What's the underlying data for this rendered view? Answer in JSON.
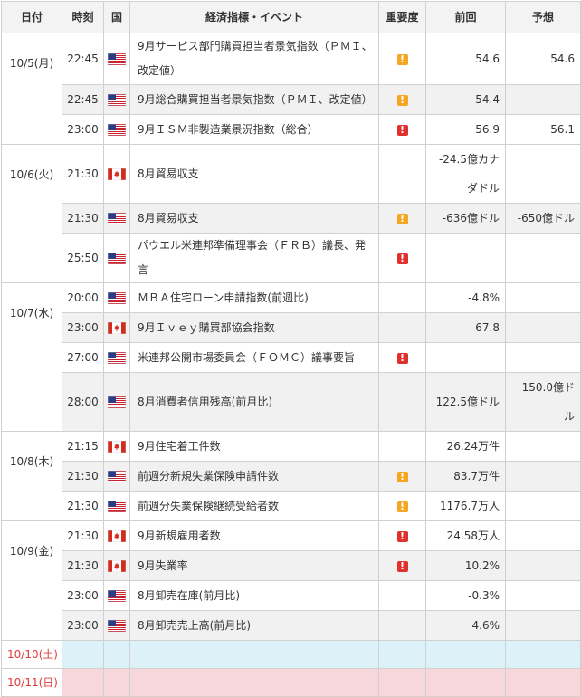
{
  "header": {
    "date": "日付",
    "time": "時刻",
    "country": "国",
    "event": "経済指標・イベント",
    "importance": "重要度",
    "previous": "前回",
    "forecast": "予想"
  },
  "colors": {
    "importance_mid": "#f5a623",
    "importance_high": "#e0312f",
    "saturday_bg": "#ddf1f8",
    "sunday_bg": "#f7d6dc",
    "weekend_text": "#e03b3b"
  },
  "days": [
    {
      "date": "10/5(月)",
      "events": [
        {
          "time": "22:45",
          "country": "us-flag-icon",
          "event": "9月サービス部門購買担当者景気指数（ＰＭＩ、改定値）",
          "importance": "mid",
          "importance_mark": "!",
          "previous": "54.6",
          "forecast": "54.6"
        },
        {
          "time": "22:45",
          "country": "us-flag-icon",
          "event": "9月総合購買担当者景気指数（ＰＭＩ、改定値）",
          "importance": "mid",
          "importance_mark": "!",
          "previous": "54.4",
          "forecast": ""
        },
        {
          "time": "23:00",
          "country": "us-flag-icon",
          "event": "9月ＩＳＭ非製造業景況指数（総合）",
          "importance": "high",
          "importance_mark": "!",
          "previous": "56.9",
          "forecast": "56.1"
        }
      ]
    },
    {
      "date": "10/6(火)",
      "events": [
        {
          "time": "21:30",
          "country": "ca-flag-icon",
          "event": "8月貿易収支",
          "importance": "",
          "importance_mark": "",
          "previous": "-24.5億カナダドル",
          "forecast": ""
        },
        {
          "time": "21:30",
          "country": "us-flag-icon",
          "event": "8月貿易収支",
          "importance": "mid",
          "importance_mark": "!",
          "previous": "-636億ドル",
          "forecast": "-650億ドル"
        },
        {
          "time": "25:50",
          "country": "us-flag-icon",
          "event": "パウエル米連邦準備理事会（ＦＲＢ）議長、発言",
          "importance": "high",
          "importance_mark": "!",
          "previous": "",
          "forecast": ""
        }
      ]
    },
    {
      "date": "10/7(水)",
      "events": [
        {
          "time": "20:00",
          "country": "us-flag-icon",
          "event": "ＭＢＡ住宅ローン申請指数(前週比)",
          "importance": "",
          "importance_mark": "",
          "previous": "-4.8%",
          "forecast": ""
        },
        {
          "time": "23:00",
          "country": "ca-flag-icon",
          "event": "9月Ｉｖｅｙ購買部協会指数",
          "importance": "",
          "importance_mark": "",
          "previous": "67.8",
          "forecast": ""
        },
        {
          "time": "27:00",
          "country": "us-flag-icon",
          "event": "米連邦公開市場委員会（ＦＯＭＣ）議事要旨",
          "importance": "high",
          "importance_mark": "!",
          "previous": "",
          "forecast": ""
        },
        {
          "time": "28:00",
          "country": "us-flag-icon",
          "event": "8月消費者信用残高(前月比)",
          "importance": "",
          "importance_mark": "",
          "previous": "122.5億ドル",
          "forecast": "150.0億ドル"
        }
      ]
    },
    {
      "date": "10/8(木)",
      "events": [
        {
          "time": "21:15",
          "country": "ca-flag-icon",
          "event": "9月住宅着工件数",
          "importance": "",
          "importance_mark": "",
          "previous": "26.24万件",
          "forecast": ""
        },
        {
          "time": "21:30",
          "country": "us-flag-icon",
          "event": "前週分新規失業保険申請件数",
          "importance": "mid",
          "importance_mark": "!",
          "previous": "83.7万件",
          "forecast": ""
        },
        {
          "time": "21:30",
          "country": "us-flag-icon",
          "event": "前週分失業保険継続受給者数",
          "importance": "mid",
          "importance_mark": "!",
          "previous": "1176.7万人",
          "forecast": ""
        }
      ]
    },
    {
      "date": "10/9(金)",
      "events": [
        {
          "time": "21:30",
          "country": "ca-flag-icon",
          "event": "9月新規雇用者数",
          "importance": "high",
          "importance_mark": "!",
          "previous": "24.58万人",
          "forecast": ""
        },
        {
          "time": "21:30",
          "country": "ca-flag-icon",
          "event": "9月失業率",
          "importance": "high",
          "importance_mark": "!",
          "previous": "10.2%",
          "forecast": ""
        },
        {
          "time": "23:00",
          "country": "us-flag-icon",
          "event": "8月卸売在庫(前月比)",
          "importance": "",
          "importance_mark": "",
          "previous": "-0.3%",
          "forecast": ""
        },
        {
          "time": "23:00",
          "country": "us-flag-icon",
          "event": "8月卸売売上高(前月比)",
          "importance": "",
          "importance_mark": "",
          "previous": "4.6%",
          "forecast": ""
        }
      ]
    }
  ],
  "weekend": [
    {
      "date": "10/10(土)",
      "type": "saturday"
    },
    {
      "date": "10/11(日)",
      "type": "sunday"
    }
  ]
}
